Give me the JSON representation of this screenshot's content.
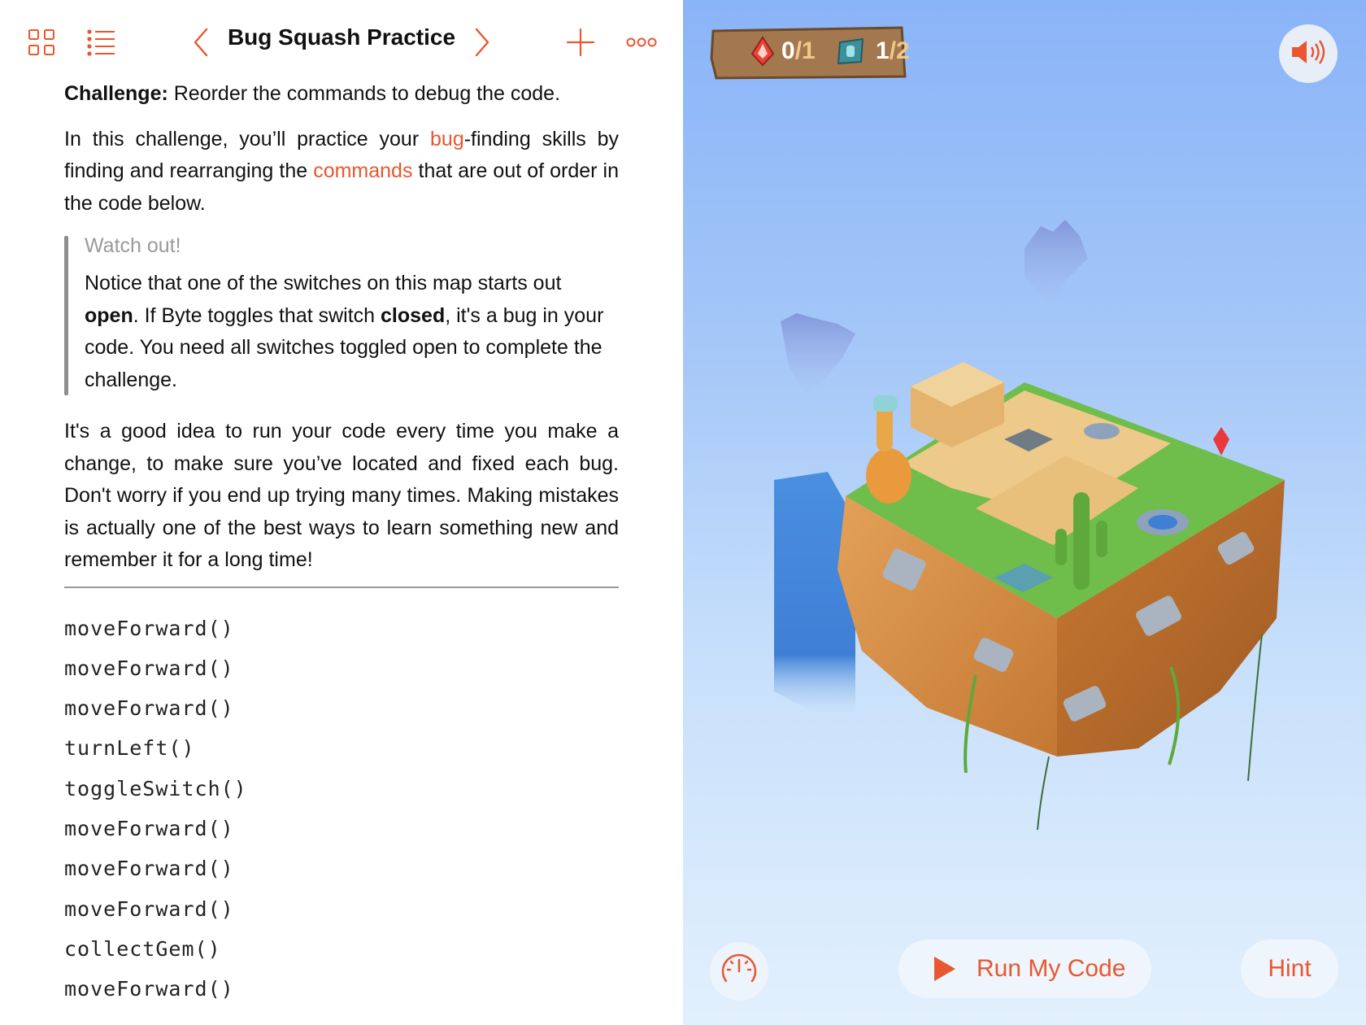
{
  "toolbar": {
    "title": "Bug Squash Practice",
    "accent": "#e8572f"
  },
  "content": {
    "challenge_label": "Challenge:",
    "challenge_text": " Reorder the commands to debug the code.",
    "intro": {
      "t1": "In this challenge, you’ll practice your ",
      "term1": "bug",
      "t2": "-finding skills by finding and rearranging the ",
      "term2": "commands",
      "t3": " that are out of order in the code below."
    },
    "callout": {
      "title": "Watch out!",
      "t1": "Notice that one of the switches on this map starts out ",
      "b1": "open",
      "t2": ". If Byte toggles that switch ",
      "b2": "closed",
      "t3": ", it's a bug in your code. You need all switches toggled open to complete the challenge."
    },
    "paragraph": "It's a good idea to run your code every time you make a change, to make sure you’ve located and fixed each bug. Don't worry if you end up trying many times. Making mistakes is actually one of the best ways to learn something new and remember it for a long time!",
    "code": [
      "moveForward()",
      "moveForward()",
      "moveForward()",
      "turnLeft()",
      "toggleSwitch()",
      "moveForward()",
      "moveForward()",
      "moveForward()",
      "collectGem()",
      "moveForward()"
    ]
  },
  "game": {
    "gems": {
      "done": "0",
      "total": "/1"
    },
    "switches": {
      "done": "1",
      "total": "/2"
    },
    "run_label": "Run My Code",
    "hint_label": "Hint",
    "icons": {
      "grid": "grid-icon",
      "list": "list-icon",
      "back": "chevron-left-icon",
      "forward": "chevron-right-icon",
      "add": "plus-icon",
      "more": "more-icon",
      "sound": "speaker-icon",
      "speed": "speedometer-icon",
      "play": "play-icon",
      "gem": "gem-icon",
      "switch": "switch-icon"
    }
  }
}
